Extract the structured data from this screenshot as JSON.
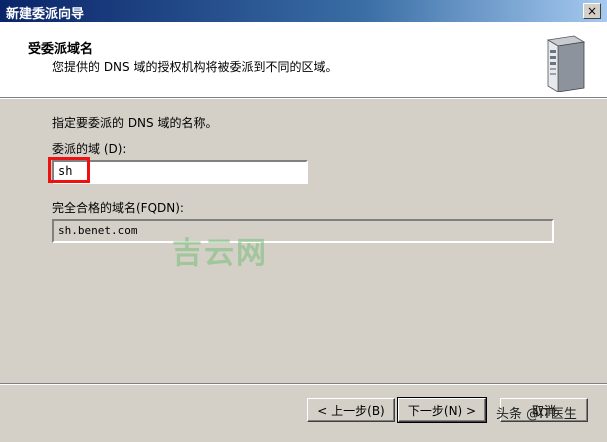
{
  "window": {
    "title": "新建委派向导",
    "close_glyph": "×"
  },
  "header": {
    "title": "受委派域名",
    "subtitle": "您提供的 DNS 域的授权机构将被委派到不同的区域。",
    "icon": "server-icon"
  },
  "form": {
    "instruction": "指定要委派的 DNS 域的名称。",
    "delegated_label": "委派的域 (D):",
    "delegated_value": "sh",
    "fqdn_label": "完全合格的域名(FQDN):",
    "fqdn_value": "sh.benet.com"
  },
  "watermark": "吉云网",
  "buttons": {
    "back": "< 上一步(B)",
    "next": "下一步(N) >",
    "cancel": "取消"
  },
  "source_mark": "头条 @IT医生",
  "colors": {
    "highlight": "#ee1111",
    "titlebar": "#0a246a"
  }
}
